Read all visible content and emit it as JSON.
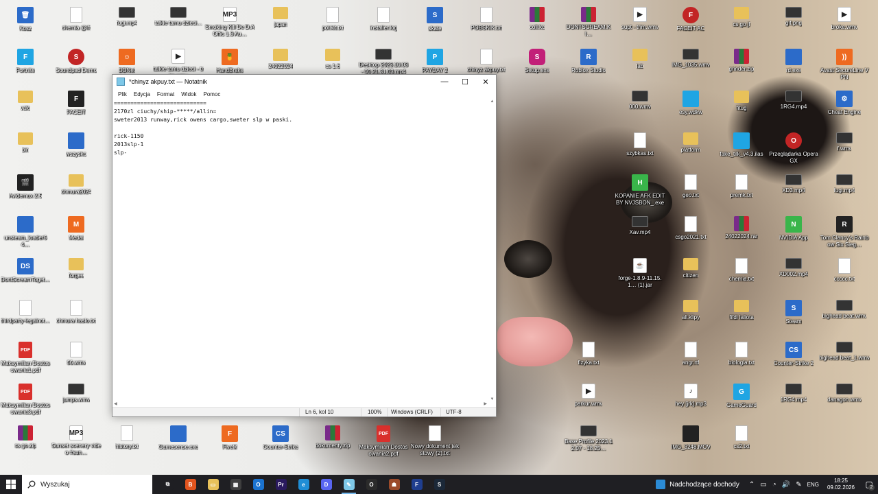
{
  "desktop": {
    "icons": [
      {
        "label": "Kosz",
        "type": "app",
        "glyph": "🗑",
        "name": "recycle-bin-icon"
      },
      {
        "label": "chemia @ift",
        "type": "file",
        "glyph": "",
        "name": "file-icon"
      },
      {
        "label": "fugi.mp4",
        "type": "video",
        "glyph": "",
        "name": "video-file-icon"
      },
      {
        "label": "talkie tamu dzieci…",
        "type": "video",
        "glyph": "",
        "name": "video-file-icon"
      },
      {
        "label": "Smoking Kill De D.A Offic 1.3 Au…",
        "type": "media",
        "glyph": "MP3",
        "name": "audio-file-icon"
      },
      {
        "label": "japan",
        "type": "folder",
        "glyph": "",
        "name": "folder-icon"
      },
      {
        "label": "pol.kit.txt",
        "type": "file",
        "glyph": "",
        "name": "text-file-icon"
      },
      {
        "label": "installer.log",
        "type": "file",
        "glyph": "",
        "name": "text-file-icon"
      },
      {
        "label": "skate",
        "type": "app",
        "glyph": "S",
        "name": "game-icon"
      },
      {
        "label": "POBSKIK.txt",
        "type": "file",
        "glyph": "",
        "name": "text-file-icon"
      },
      {
        "label": "coll.kc",
        "type": "zip",
        "glyph": "",
        "name": "archive-icon"
      },
      {
        "label": "DONTSCREAM.KI…",
        "type": "zip",
        "glyph": "",
        "name": "archive-icon"
      },
      {
        "label": "supt - trim.wmv",
        "type": "media",
        "glyph": "▶",
        "name": "video-file-icon"
      },
      {
        "label": "FACEIT AC",
        "type": "red",
        "glyph": "F",
        "name": "faceit-ac-icon"
      },
      {
        "label": "cs go jf",
        "type": "folder",
        "glyph": "",
        "name": "folder-icon"
      },
      {
        "label": "gif.png",
        "type": "video",
        "glyph": "",
        "name": "image-file-icon"
      },
      {
        "label": "broke.wmv",
        "type": "media",
        "glyph": "▶",
        "name": "video-file-icon"
      },
      {
        "label": "Fortnite",
        "type": "cyan",
        "glyph": "F",
        "name": "fortnite-icon"
      },
      {
        "label": "Soundpad Demo",
        "type": "red",
        "glyph": "S",
        "name": "soundpad-icon"
      },
      {
        "label": "DDNet",
        "type": "orange",
        "glyph": "☺",
        "name": "ddnet-icon"
      },
      {
        "label": "talkie tamu dzieci - trim.wmv",
        "type": "media",
        "glyph": "▶",
        "name": "video-file-icon"
      },
      {
        "label": "HandBrake",
        "type": "orange",
        "glyph": "🍍",
        "name": "handbrake-icon"
      },
      {
        "label": "24022024",
        "type": "folder",
        "glyph": "",
        "name": "folder-icon"
      },
      {
        "label": "cs 1.6",
        "type": "folder",
        "glyph": "",
        "name": "folder-icon"
      },
      {
        "label": "Desktop 2023.10.03 - 00.21.31.03.mp4",
        "type": "video",
        "glyph": "",
        "name": "video-file-icon"
      },
      {
        "label": "PAYDAY 2",
        "type": "cyan",
        "glyph": "P",
        "name": "payday-icon"
      },
      {
        "label": "chinyz akpuy.txt",
        "type": "file",
        "glyph": "",
        "name": "text-file-icon"
      },
      {
        "label": "Setup.exe",
        "type": "pink",
        "glyph": "S",
        "name": "setup-icon"
      },
      {
        "label": "Roblox Studio",
        "type": "app",
        "glyph": "R",
        "name": "roblox-studio-icon"
      },
      {
        "label": "lab",
        "type": "folder",
        "glyph": "",
        "name": "folder-icon"
      },
      {
        "label": "IMG_1035.wmv",
        "type": "video",
        "glyph": "",
        "name": "video-file-icon"
      },
      {
        "label": "grinder.zip",
        "type": "zip",
        "glyph": "",
        "name": "archive-icon"
      },
      {
        "label": "rd.exe",
        "type": "app",
        "glyph": "",
        "name": "exe-icon"
      },
      {
        "label": "Avast SecureLine VPN",
        "type": "orange",
        "glyph": "))",
        "name": "avast-vpn-icon"
      },
      {
        "label": "valo",
        "type": "folder",
        "glyph": "",
        "name": "folder-icon"
      },
      {
        "label": "FACEIT",
        "type": "dark",
        "glyph": "F",
        "name": "faceit-icon"
      },
      {
        "label": "000.wmv",
        "type": "video",
        "glyph": "",
        "name": "video-file-icon"
      },
      {
        "label": "esy.wdkw",
        "type": "cyan",
        "glyph": "",
        "name": "file-icon"
      },
      {
        "label": "fitug",
        "type": "folder",
        "glyph": "",
        "name": "folder-icon"
      },
      {
        "label": "1RG4.mp4",
        "type": "video",
        "glyph": "",
        "name": "video-file-icon"
      },
      {
        "label": "Cheat Engine",
        "type": "app",
        "glyph": "⚙",
        "name": "cheat-engine-icon"
      },
      {
        "label": "bin",
        "type": "folder",
        "glyph": "",
        "name": "folder-icon"
      },
      {
        "label": "wszysko",
        "type": "app",
        "glyph": "",
        "name": "folder-icon"
      },
      {
        "label": "szybkas.txt",
        "type": "file",
        "glyph": "",
        "name": "text-file-icon"
      },
      {
        "label": "platform",
        "type": "folder",
        "glyph": "",
        "name": "folder-icon"
      },
      {
        "label": "fake_tilk_v4.3.ilas",
        "type": "cyan",
        "glyph": "",
        "name": "file-icon"
      },
      {
        "label": "Przeglądarka Opera GX",
        "type": "red",
        "glyph": "O",
        "name": "opera-gx-icon"
      },
      {
        "label": "f.wmv",
        "type": "video",
        "glyph": "",
        "name": "video-file-icon"
      },
      {
        "label": "Avidemux 2.5",
        "type": "dark",
        "glyph": "🎬",
        "name": "avidemux-icon"
      },
      {
        "label": "chmura2024",
        "type": "folder",
        "glyph": "",
        "name": "folder-icon"
      },
      {
        "label": "KOPANIE AFK EDIT BY NVJSBON_.exe",
        "type": "green",
        "glyph": "H",
        "name": "exe-icon"
      },
      {
        "label": "geo.txt",
        "type": "file",
        "glyph": "",
        "name": "text-file-icon"
      },
      {
        "label": "premk.txt",
        "type": "file",
        "glyph": "",
        "name": "text-file-icon"
      },
      {
        "label": "XD3.mp4",
        "type": "video",
        "glyph": "",
        "name": "video-file-icon"
      },
      {
        "label": "fugi.mp4",
        "type": "video",
        "glyph": "",
        "name": "video-file-icon"
      },
      {
        "label": "unsteam_loader64…",
        "type": "app",
        "glyph": "",
        "name": "exe-icon"
      },
      {
        "label": "Medal",
        "type": "orange",
        "glyph": "M",
        "name": "medal-icon"
      },
      {
        "label": "Xav.mp4",
        "type": "video",
        "glyph": "",
        "name": "video-file-icon"
      },
      {
        "label": "csgo2021.txt",
        "type": "file",
        "glyph": "",
        "name": "text-file-icon"
      },
      {
        "label": "24022024.rar",
        "type": "zip",
        "glyph": "",
        "name": "archive-icon"
      },
      {
        "label": "NVIDIA App",
        "type": "green",
        "glyph": "N",
        "name": "nvidia-icon"
      },
      {
        "label": "Tom Clancy's Rainbow Six Sieg…",
        "type": "dark",
        "glyph": "R",
        "name": "rainbow-six-icon"
      },
      {
        "label": "DontScreamToget…",
        "type": "app",
        "glyph": "DS",
        "name": "game-icon"
      },
      {
        "label": "forgee",
        "type": "folder",
        "glyph": "",
        "name": "folder-icon"
      },
      {
        "label": "forge-1.8.9-11.15.1… (1).jar",
        "type": "media",
        "glyph": "☕",
        "name": "java-file-icon"
      },
      {
        "label": "citizen",
        "type": "folder",
        "glyph": "",
        "name": "folder-icon"
      },
      {
        "label": "chemia.txt",
        "type": "file",
        "glyph": "",
        "name": "text-file-icon"
      },
      {
        "label": "XD002.mp4",
        "type": "video",
        "glyph": "",
        "name": "video-file-icon"
      },
      {
        "label": "ccccc.txt",
        "type": "file",
        "glyph": "",
        "name": "text-file-icon"
      },
      {
        "label": "thirdparty-legalnot…",
        "type": "file",
        "glyph": "",
        "name": "text-file-icon"
      },
      {
        "label": "chmura haslo.txt",
        "type": "file",
        "glyph": "",
        "name": "text-file-icon"
      },
      {
        "label": "all.klipy",
        "type": "folder",
        "glyph": "",
        "name": "folder-icon"
      },
      {
        "label": "fifdi laliota",
        "type": "folder",
        "glyph": "",
        "name": "folder-icon"
      },
      {
        "label": "Steam",
        "type": "app",
        "glyph": "S",
        "name": "steam-icon"
      },
      {
        "label": "bighead beat.wmv",
        "type": "video",
        "glyph": "",
        "name": "video-file-icon"
      },
      {
        "label": "Maksymilian Dostosowania1.pdf",
        "type": "pdf",
        "glyph": "PDF",
        "name": "pdf-file-icon"
      },
      {
        "label": "66.wmv",
        "type": "file",
        "glyph": "",
        "name": "video-file-icon"
      },
      {
        "label": "fizyka.txt",
        "type": "file",
        "glyph": "",
        "name": "text-file-icon"
      },
      {
        "label": "angr.rtf",
        "type": "file",
        "glyph": "",
        "name": "file-icon"
      },
      {
        "label": "biologia.txt",
        "type": "file",
        "glyph": "",
        "name": "text-file-icon"
      },
      {
        "label": "Counter-Strike 2",
        "type": "app",
        "glyph": "CS",
        "name": "counter-strike-2-icon"
      },
      {
        "label": "bighead beat_1.wmv",
        "type": "video",
        "glyph": "",
        "name": "video-file-icon"
      },
      {
        "label": "Maksymilian Dostosowania3.pdf",
        "type": "pdf",
        "glyph": "PDF",
        "name": "pdf-file-icon"
      },
      {
        "label": "jumps.wmv",
        "type": "video",
        "glyph": "",
        "name": "video-file-icon"
      },
      {
        "label": "parkur.wmv",
        "type": "media",
        "glyph": "▶",
        "name": "video-file-icon"
      },
      {
        "label": "hey [jrk].mp3",
        "type": "media",
        "glyph": "♪",
        "name": "audio-file-icon"
      },
      {
        "label": "GameGuard",
        "type": "cyan",
        "glyph": "G",
        "name": "gameguard-icon"
      },
      {
        "label": "1RG4.mp4",
        "type": "video",
        "glyph": "",
        "name": "video-file-icon"
      },
      {
        "label": "danagon.wmv",
        "type": "video",
        "glyph": "",
        "name": "video-file-icon"
      },
      {
        "label": "cs go.zip",
        "type": "zip",
        "glyph": "",
        "name": "archive-icon"
      },
      {
        "label": "Sunset scenery video #sun…",
        "type": "media",
        "glyph": "MP3",
        "name": "audio-file-icon"
      },
      {
        "label": "history.txt",
        "type": "file",
        "glyph": "",
        "name": "text-file-icon"
      },
      {
        "label": "Gamesense.exe",
        "type": "app",
        "glyph": "",
        "name": "exe-icon"
      },
      {
        "label": "FiveM",
        "type": "orange",
        "glyph": "F",
        "name": "fivem-icon"
      },
      {
        "label": "Counter-Strike",
        "type": "app",
        "glyph": "CS",
        "name": "counter-strike-icon"
      },
      {
        "label": "dokumenty.zip",
        "type": "zip",
        "glyph": "",
        "name": "archive-icon"
      },
      {
        "label": "Maksymilian Dostosowania2.pdf",
        "type": "pdf",
        "glyph": "PDF",
        "name": "pdf-file-icon"
      },
      {
        "label": "Nowy dokument tekstowy (2).txt",
        "type": "file",
        "glyph": "",
        "name": "text-file-icon"
      },
      {
        "label": "Base Profile 2023.12.07 - 18.25…",
        "type": "video",
        "glyph": "",
        "name": "video-file-icon"
      },
      {
        "label": "IMG_3248.MOV",
        "type": "dark",
        "glyph": "",
        "name": "video-file-icon"
      },
      {
        "label": "cs2.txt",
        "type": "file",
        "glyph": "",
        "name": "text-file-icon"
      }
    ]
  },
  "notepad": {
    "title": "*chinyz akpuy.txt — Notatnik",
    "menu": [
      "Plik",
      "Edycja",
      "Format",
      "Widok",
      "Pomoc"
    ],
    "content": "============================\n2170zl ciuchy/ship-*****/allin=\nsweter2013 runway,rick owens cargo,sweter slp w paski.\n\nrick-1150\n2013slp-1\nslp-",
    "status": {
      "position": "Ln 6, kol 10",
      "zoom": "100%",
      "line_ending": "Windows (CRLF)",
      "encoding": "UTF-8"
    }
  },
  "taskbar": {
    "search_placeholder": "Wyszukaj",
    "news": "Nadchodzące dochody",
    "language": "ENG",
    "time": "18:25",
    "date": "09.02.2026",
    "notifications": "2",
    "apps": [
      {
        "name": "task-view-icon",
        "glyph": "⧉",
        "color": "#1f1f23"
      },
      {
        "name": "brave-icon",
        "glyph": "B",
        "color": "#e2541e"
      },
      {
        "name": "file-explorer-icon",
        "glyph": "▭",
        "color": "#e8c15a"
      },
      {
        "name": "microsoft-store-icon",
        "glyph": "▦",
        "color": "#3e3e3e"
      },
      {
        "name": "outlook-icon",
        "glyph": "O",
        "color": "#1b73d0"
      },
      {
        "name": "premiere-pro-icon",
        "glyph": "Pr",
        "color": "#2a1a5e"
      },
      {
        "name": "edge-icon",
        "glyph": "e",
        "color": "#1f8ed6"
      },
      {
        "name": "discord-icon",
        "glyph": "D",
        "color": "#5865f2"
      },
      {
        "name": "notepad-icon",
        "glyph": "✎",
        "color": "#7ec8e8"
      },
      {
        "name": "opera-gx-icon",
        "glyph": "O",
        "color": "#2b2b2b"
      },
      {
        "name": "game-icon",
        "glyph": "☗",
        "color": "#9b4a2a"
      },
      {
        "name": "faceit-ac-icon",
        "glyph": "F",
        "color": "#1f3e8f"
      },
      {
        "name": "steam-icon",
        "glyph": "S",
        "color": "#1b2838"
      }
    ]
  }
}
